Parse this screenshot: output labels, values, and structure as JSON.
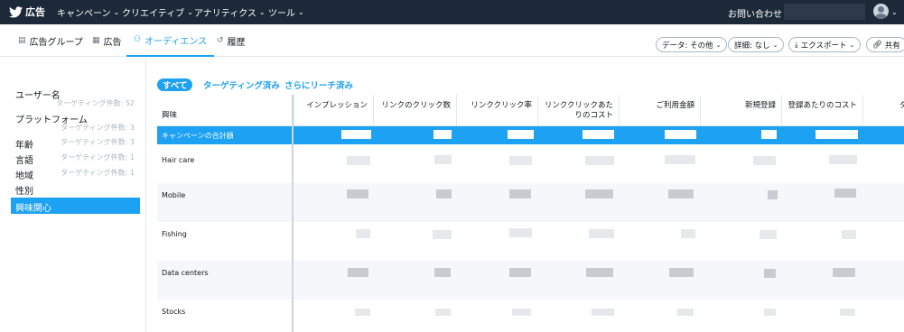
{
  "nav": {
    "brand": "広告",
    "menu": [
      "キャンペーン",
      "クリエイティブ",
      "アナリティクス",
      "ツール"
    ],
    "contact": "お問い合わせ",
    "bg_color": "#1c2938"
  },
  "tabs": [
    {
      "label": "広告グループ",
      "icon": "ad-group-icon"
    },
    {
      "label": "広告",
      "icon": "ad-icon"
    },
    {
      "label": "オーディエンス",
      "icon": "audience-icon",
      "active": true
    },
    {
      "label": "履歴",
      "icon": "history-icon"
    }
  ],
  "toolbar": {
    "data_label": "データ: その他",
    "detail_label": "詳細: なし",
    "export_label": "エクスポート",
    "share_label": "共有"
  },
  "sidebar": {
    "items": [
      {
        "label": "ユーザー名",
        "count": "ターゲティング件数: 52"
      },
      {
        "label": "プラットフォーム",
        "count": "ターゲティング件数: 3"
      },
      {
        "label": "年齢",
        "count": "ターゲティング件数: 3"
      },
      {
        "label": "言語",
        "count": "ターゲティング件数: 1"
      },
      {
        "label": "地域",
        "count": "ターゲティング件数: 1"
      },
      {
        "label": "性別",
        "count": ""
      },
      {
        "label": "興味関心",
        "count": "",
        "active": true
      }
    ]
  },
  "filters": [
    "すべて",
    "ターゲティング済み",
    "さらにリーチ済み"
  ],
  "table": {
    "columns": [
      "興味",
      "インプレッション",
      "リンクのクリック数",
      "リンククリック率",
      "リンククリックあたりのコスト",
      "ご利用金額",
      "新規登録",
      "登録あたりのコスト",
      "ダ"
    ],
    "total_label": "キャンペーンの合計額",
    "rows": [
      "Hair care",
      "Mobile",
      "Fishing",
      "Data centers",
      "Stocks"
    ],
    "values_redacted": true
  },
  "colors": {
    "accent": "#1da1f2",
    "row_alt": "#f5f8fa"
  }
}
